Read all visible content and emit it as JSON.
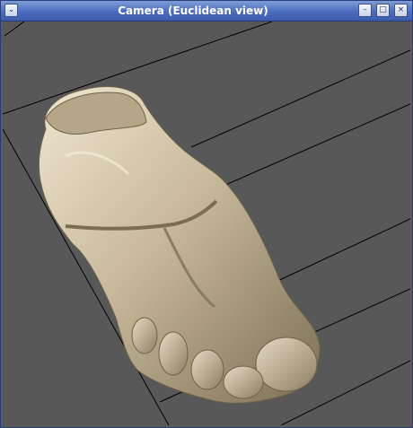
{
  "window": {
    "title": "Camera (Euclidean view)",
    "menu_icon": "chevron-down-icon",
    "minimize_icon": "minimize-icon",
    "maximize_icon": "maximize-icon",
    "close_icon": "close-icon",
    "menu_glyph": "⌄",
    "minimize_glyph": "–",
    "maximize_glyph": "□",
    "close_glyph": "×"
  },
  "viewport": {
    "background": "#585858",
    "grid_line_color": "#000000",
    "model_color": "#c8b99a",
    "model": "foot-3d-model"
  }
}
